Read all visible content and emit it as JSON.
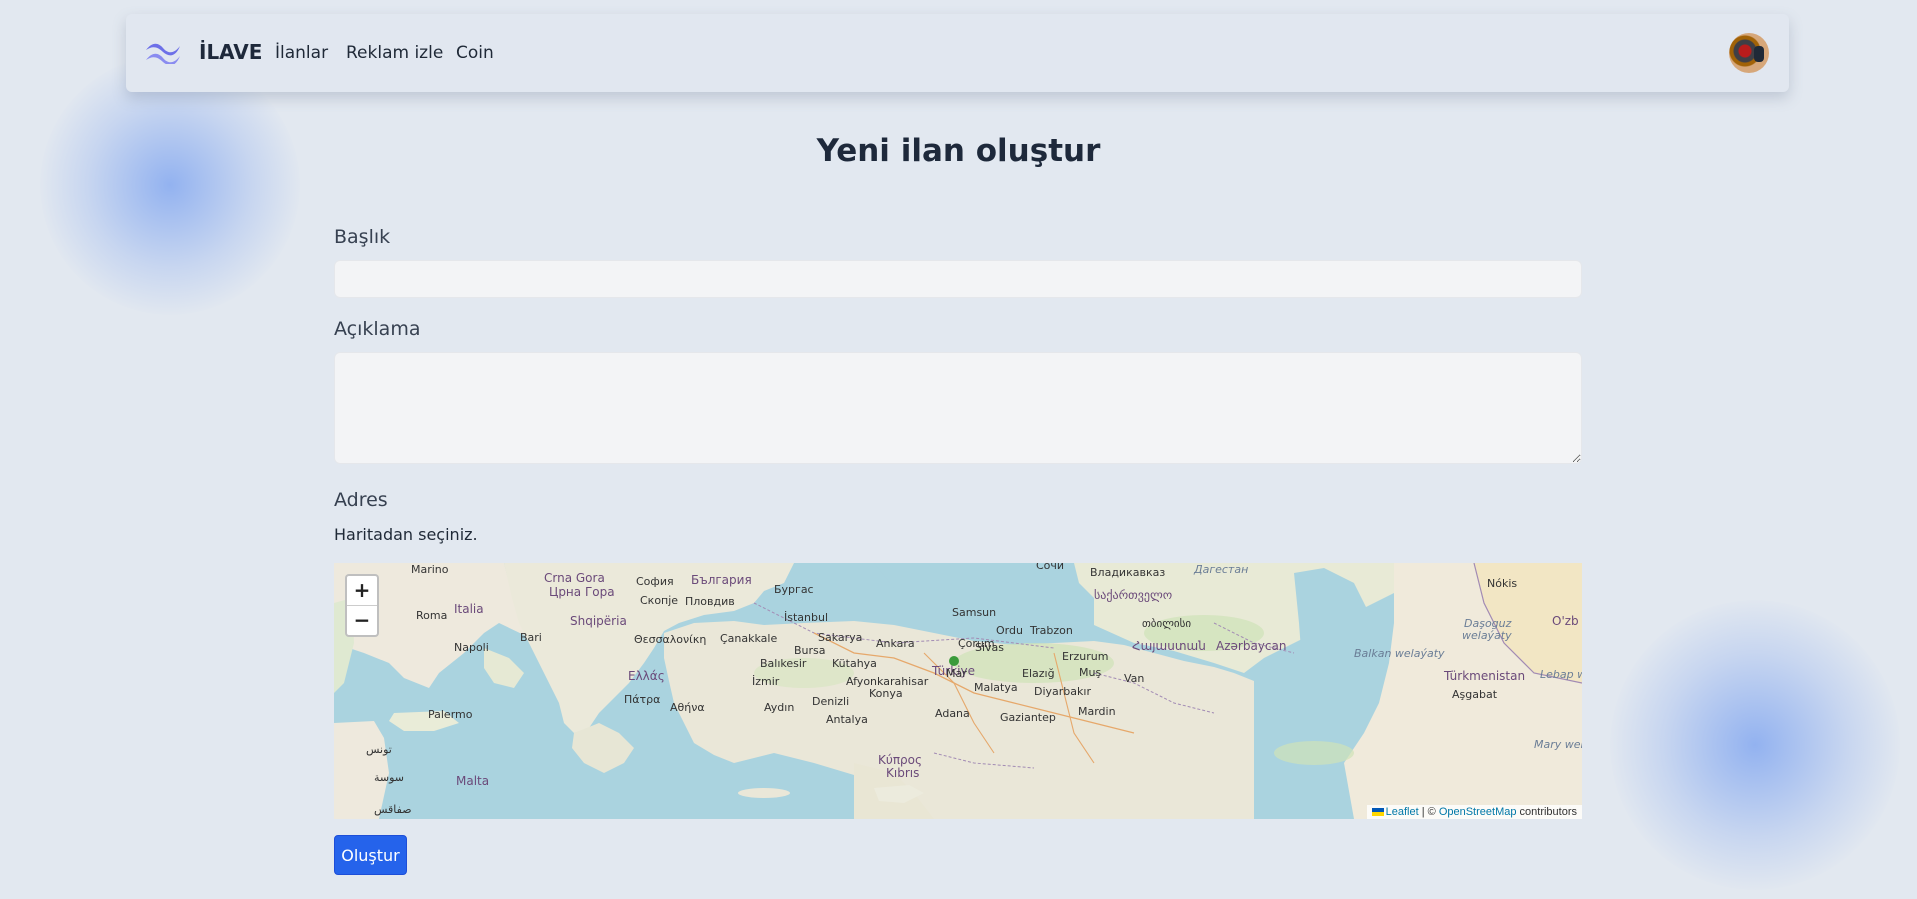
{
  "navbar": {
    "brand": "İLAVE",
    "links": [
      "İlanlar",
      "Reklam izle",
      "Coin"
    ]
  },
  "form": {
    "title": "Yeni ilan oluştur",
    "title_label": "Başlık",
    "title_value": "",
    "description_label": "Açıklama",
    "description_value": "",
    "address_label": "Adres",
    "address_hint": "Haritadan seçiniz.",
    "submit_label": "Oluştur"
  },
  "map": {
    "zoom_in": "+",
    "zoom_out": "−",
    "attribution": {
      "leaflet": "Leaflet",
      "separator": " | © ",
      "osm": "OpenStreetMap",
      "suffix": " contributors"
    },
    "labels": {
      "marino": "Marino",
      "roma": "Roma",
      "italia": "Italia",
      "bari": "Bari",
      "napoli": "Napoli",
      "palermo": "Palermo",
      "malta": "Malta",
      "tunis": "تونس",
      "sousse": "سوسة",
      "sfax": "صفاقس",
      "crna_gora": "Crna Gora",
      "crna_gora_cyr": "Црна Гора",
      "sofia": "София",
      "bulgaria": "България",
      "skopje": "Скопје",
      "plovdiv": "Пловдив",
      "burgas": "Бургас",
      "shqiperia": "Shqipëria",
      "thessaloniki": "Θεσσαλονίκη",
      "ellas": "Ελλάς",
      "patra": "Πάτρα",
      "athina": "Αθήνα",
      "istanbul": "İstanbul",
      "canakkale": "Çanakkale",
      "bursa": "Bursa",
      "balikesir": "Balıkesir",
      "izmir": "İzmir",
      "aydin": "Aydın",
      "denizli": "Denizli",
      "antalya": "Antalya",
      "kutahya": "Kütahya",
      "afyon": "Afyonkarahisar",
      "konya": "Konya",
      "sakarya": "Sakarya",
      "ankara": "Ankara",
      "corum": "Çorum",
      "samsun": "Samsun",
      "ordu": "Ordu",
      "trabzon": "Trabzon",
      "sivas": "Sivas",
      "turkiye": "Türkiye",
      "erzurum": "Erzurum",
      "elazig": "Elazığ",
      "mus": "Muş",
      "van": "Van",
      "malatya": "Malatya",
      "diyarbakir": "Diyarbakır",
      "gaziantep": "Gaziantep",
      "adana": "Adana",
      "mardin": "Mardin",
      "kypros": "Κύπρος",
      "kibris": "Kıbrıs",
      "sochi": "Сочи",
      "vladikavkaz": "Владикавказ",
      "dagestan": "Дагестан",
      "sakartvelo": "საქართველო",
      "tbilisi": "თბილისი",
      "hayastan": "Հայաստան",
      "azerbaycan": "Azərbaycan",
      "nokis": "Nókis",
      "dasoguz": "Daşoguz",
      "welayaty": "welaýaty",
      "ozb": "O'zb",
      "balkan": "Balkan welaýaty",
      "turkmenistan": "Türkmenistan",
      "lebap": "Lebap we",
      "asgabat": "Aşgabat",
      "mary": "Mary welaý",
      "marker_label": "Mar"
    }
  }
}
